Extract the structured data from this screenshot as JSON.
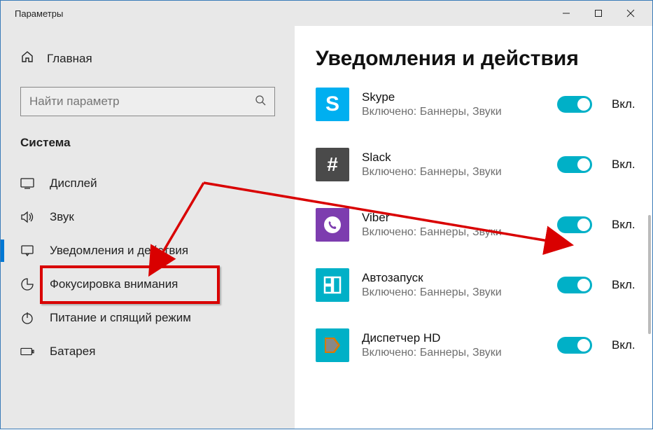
{
  "window": {
    "title": "Параметры"
  },
  "sidebar": {
    "home": "Главная",
    "search_placeholder": "Найти параметр",
    "category": "Система",
    "items": [
      {
        "label": "Дисплей",
        "icon": "display"
      },
      {
        "label": "Звук",
        "icon": "sound"
      },
      {
        "label": "Уведомления и действия",
        "icon": "notifications",
        "selected": true
      },
      {
        "label": "Фокусировка внимания",
        "icon": "focus"
      },
      {
        "label": "Питание и спящий режим",
        "icon": "power"
      },
      {
        "label": "Батарея",
        "icon": "battery"
      }
    ]
  },
  "main": {
    "heading": "Уведомления и действия",
    "toggle_on_label": "Вкл.",
    "apps": [
      {
        "name": "Skype",
        "sub": "Включено: Баннеры, Звуки",
        "icon": "skype"
      },
      {
        "name": "Slack",
        "sub": "Включено: Баннеры, Звуки",
        "icon": "slack"
      },
      {
        "name": "Viber",
        "sub": "Включено: Баннеры, Звуки",
        "icon": "viber"
      },
      {
        "name": "Автозапуск",
        "sub": "Включено: Баннеры, Звуки",
        "icon": "auto"
      },
      {
        "name": "Диспетчер HD",
        "sub": "Включено: Баннеры, Звуки",
        "icon": "hd"
      }
    ]
  },
  "annotations": {
    "highlight": "sidebar-item-notifications",
    "arrows_to": [
      "sidebar-item-notifications",
      "toggle-viber"
    ]
  }
}
